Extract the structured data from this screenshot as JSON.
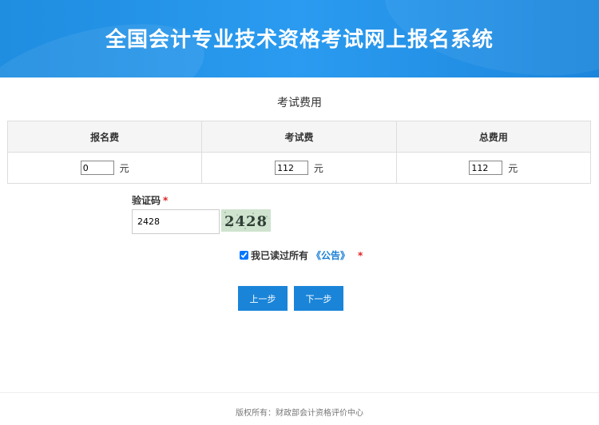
{
  "header": {
    "title": "全国会计专业技术资格考试网上报名系统"
  },
  "section_title": "考试费用",
  "fees": {
    "columns": [
      "报名费",
      "考试费",
      "总费用"
    ],
    "values": [
      "0",
      "112",
      "112"
    ],
    "unit": "元"
  },
  "captcha": {
    "label": "验证码",
    "required_mark": "*",
    "value": "2428",
    "image_text": "2428"
  },
  "agreement": {
    "checked": true,
    "text": "我已读过所有",
    "link": "《公告》",
    "required_mark": "*"
  },
  "buttons": {
    "prev": "上一步",
    "next": "下一步"
  },
  "footer": {
    "text": "版权所有：财政部会计资格评价中心"
  },
  "colors": {
    "header": "#2a9bf0",
    "button": "#1a84d8",
    "link": "#1a7fd6",
    "required": "#e02020"
  }
}
